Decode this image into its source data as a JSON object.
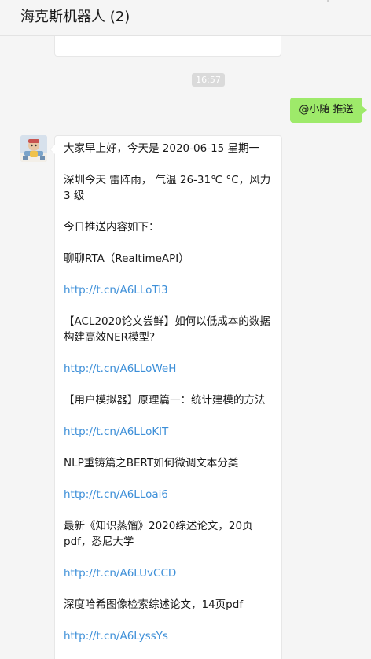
{
  "header": {
    "chat_title": "海克斯机器人 (2)",
    "more_icon": "more-icon"
  },
  "timestamp": "16:57",
  "sent_message": "@小随 推送",
  "received": {
    "greeting": "大家早上好，今天是 2020-06-15 星期一",
    "weather": "深圳今天 雷阵雨， 气温 26-31℃ °C，风力 3 级",
    "intro": "今日推送内容如下：",
    "items": [
      {
        "title": "聊聊RTA（RealtimeAPI）",
        "link": "http://t.cn/A6LLoTi3"
      },
      {
        "title": "【ACL2020论文尝鲜】如何以低成本的数据构建高效NER模型?",
        "link": "http://t.cn/A6LLoWeH"
      },
      {
        "title": "【用户模拟器】原理篇一：统计建模的方法",
        "link": "http://t.cn/A6LLoKlT"
      },
      {
        "title": "NLP重铸篇之BERT如何微调文本分类",
        "link": "http://t.cn/A6LLoai6"
      },
      {
        "title": "最新《知识蒸馏》2020综述论文，20页pdf，悉尼大学",
        "link": "http://t.cn/A6LUvCCD"
      },
      {
        "title": "深度哈希图像检索综述论文，14页pdf",
        "link": "http://t.cn/A6LyssYs"
      }
    ]
  },
  "colors": {
    "sent_bubble": "#9eea6a",
    "link": "#3d8fd8",
    "timestamp_bg": "#dadada"
  }
}
